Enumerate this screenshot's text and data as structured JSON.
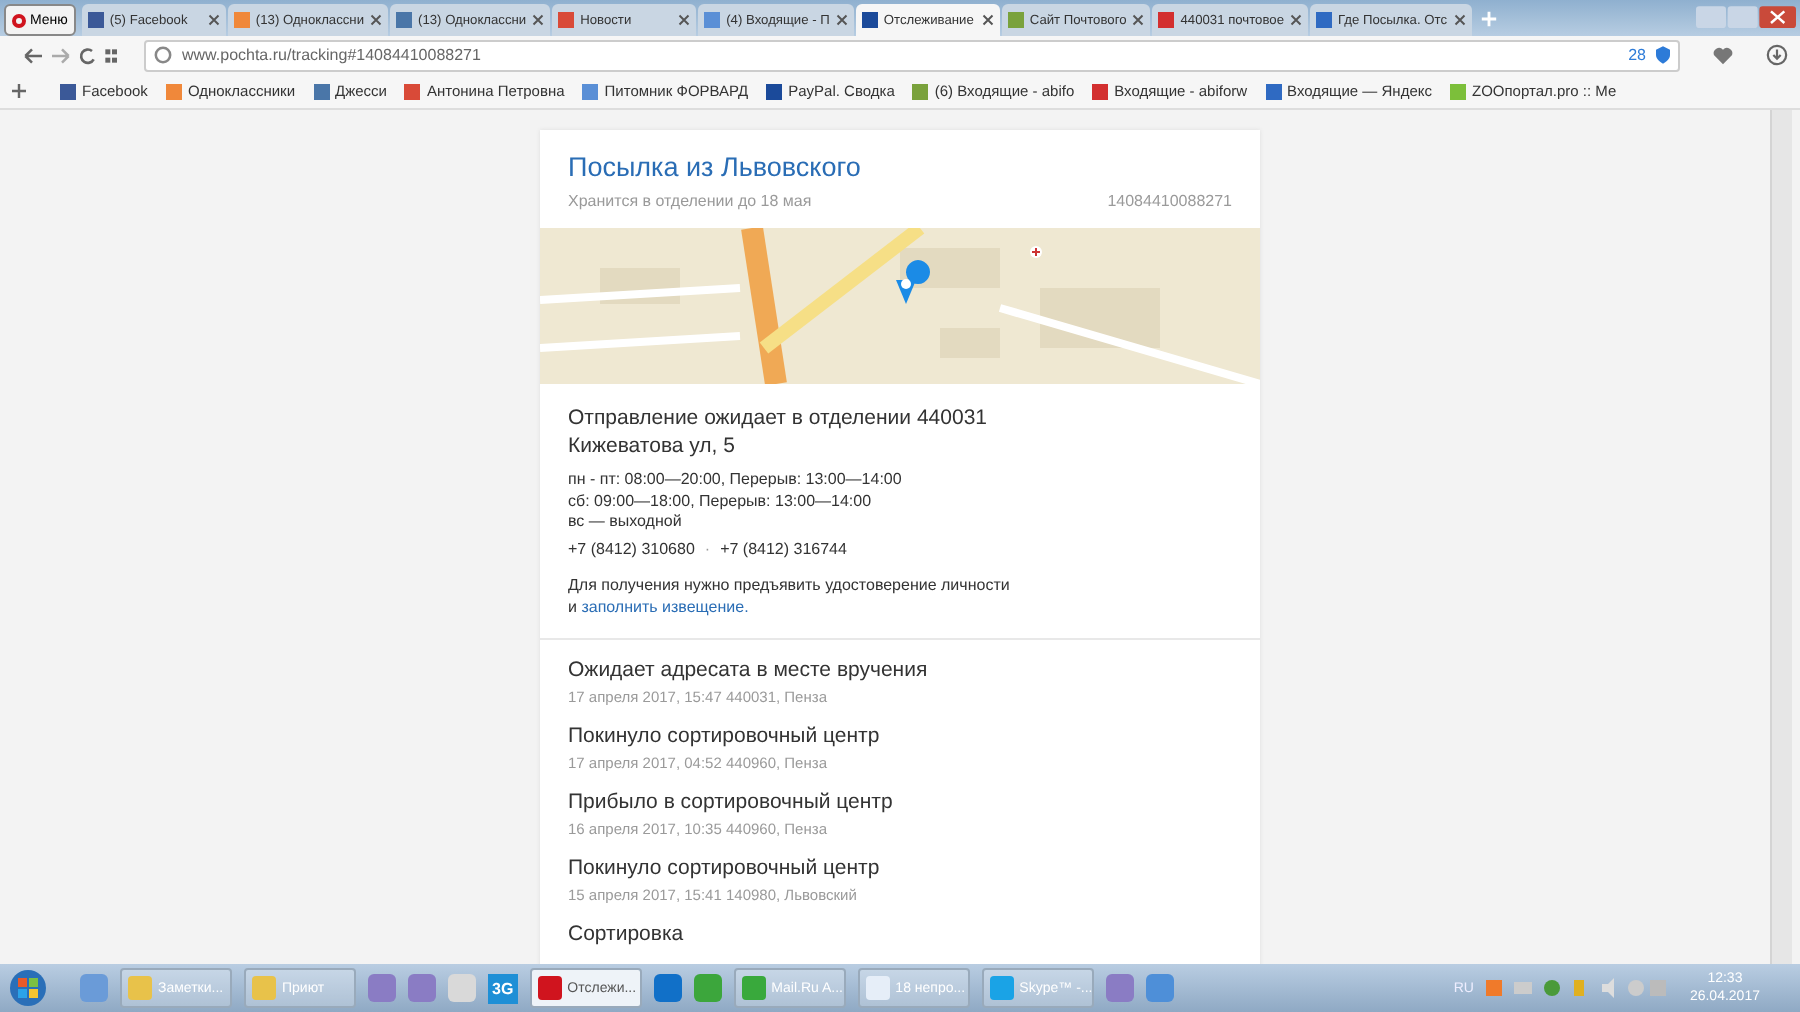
{
  "browser": {
    "menu_label": "Меню",
    "tabs": [
      {
        "title": "(5) Facebook",
        "selected": false
      },
      {
        "title": "(13) Одноклассни",
        "selected": false
      },
      {
        "title": "(13) Одноклассни",
        "selected": false
      },
      {
        "title": "Новости",
        "selected": false
      },
      {
        "title": "(4) Входящие - П",
        "selected": false
      },
      {
        "title": "Отслеживание",
        "selected": true
      },
      {
        "title": "Сайт Почтового",
        "selected": false
      },
      {
        "title": "440031 почтовое",
        "selected": false
      },
      {
        "title": "Где Посылка. Отс",
        "selected": false
      }
    ],
    "address": "www.pochta.ru/tracking#14084410088271",
    "blocked_count": "28",
    "bookmarks": [
      "Facebook",
      "Одноклассники",
      "Джесси",
      "Антонина Петровна",
      "Питомник ФОРВАРД",
      "PayPal. Сводка",
      "(6) Входящие - abifo",
      "Входящие - abiforw",
      "Входящие — Яндекс",
      "ZOOпортал.pro :: Ме"
    ]
  },
  "parcel": {
    "title": "Посылка из Львовского",
    "storage_note": "Хранится в отделении до 18 мая",
    "tracking_number": "14084410088271",
    "office": {
      "heading": "Отправление ожидает в отделении 440031",
      "address": "Кижеватова ул, 5",
      "hours": [
        "пн - пт: 08:00—20:00, Перерыв: 13:00—14:00",
        "сб: 09:00—18:00, Перерыв: 13:00—14:00",
        "вс — выходной"
      ],
      "phones": [
        "+7 (8412) 310680",
        "+7 (8412) 316744"
      ],
      "phone_separator": "·",
      "note": "Для получения нужно предъявить удостоверение личности",
      "note_prefix": "и",
      "note_link": "заполнить извещение",
      "note_suffix": "."
    },
    "history": [
      {
        "status": "Ожидает адресата в месте вручения",
        "details": "17 апреля 2017, 15:47 440031, Пенза"
      },
      {
        "status": "Покинуло сортировочный центр",
        "details": "17 апреля 2017, 04:52 440960, Пенза"
      },
      {
        "status": "Прибыло в сортировочный центр",
        "details": "16 апреля 2017, 10:35 440960, Пенза"
      },
      {
        "status": "Покинуло сортировочный центр",
        "details": "15 апреля 2017, 15:41 140980, Львовский"
      },
      {
        "status": "Сортировка"
      }
    ]
  },
  "taskbar": {
    "items": [
      {
        "kind": "calc"
      },
      {
        "kind": "folder",
        "label": "Заметки..."
      },
      {
        "kind": "folder",
        "label": "Приют"
      },
      {
        "kind": "app"
      },
      {
        "kind": "app"
      },
      {
        "kind": "cards"
      },
      {
        "kind": "badge",
        "label": "3G"
      },
      {
        "kind": "opera",
        "label": "Отслежи...",
        "selected": true
      },
      {
        "kind": "teamviewer"
      },
      {
        "kind": "leaf"
      },
      {
        "kind": "mailru",
        "label": "Mail.Ru A..."
      },
      {
        "kind": "mail",
        "label": "18 непро..."
      },
      {
        "kind": "skype",
        "label": "Skype™ -..."
      },
      {
        "kind": "app"
      },
      {
        "kind": "speaker"
      }
    ],
    "language": "RU",
    "time": "12:33",
    "date": "26.04.2017"
  }
}
